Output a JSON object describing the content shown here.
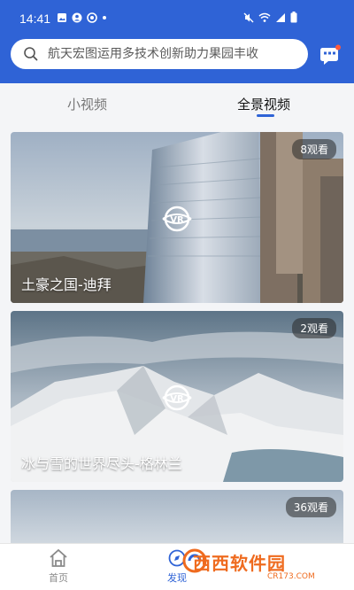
{
  "status_bar": {
    "time": "14:41"
  },
  "search": {
    "placeholder": "航天宏图运用多技术创新助力果园丰收"
  },
  "tabs": [
    {
      "label": "小视频",
      "active": false
    },
    {
      "label": "全景视频",
      "active": true
    }
  ],
  "cards": [
    {
      "views": "8观看",
      "title": "土豪之国-迪拜"
    },
    {
      "views": "2观看",
      "title": "冰与雪的世界尽头-格林兰"
    },
    {
      "views": "36观看",
      "title": ""
    }
  ],
  "bottom_nav": [
    {
      "label": "首页",
      "icon": "home-icon"
    },
    {
      "label": "发现",
      "icon": "discover-icon"
    }
  ],
  "watermark": {
    "brand": "西西软件园",
    "url": "CR173.COM"
  },
  "colors": {
    "brand_blue": "#2f63d6",
    "watermark_orange": "#ef6b1f"
  }
}
